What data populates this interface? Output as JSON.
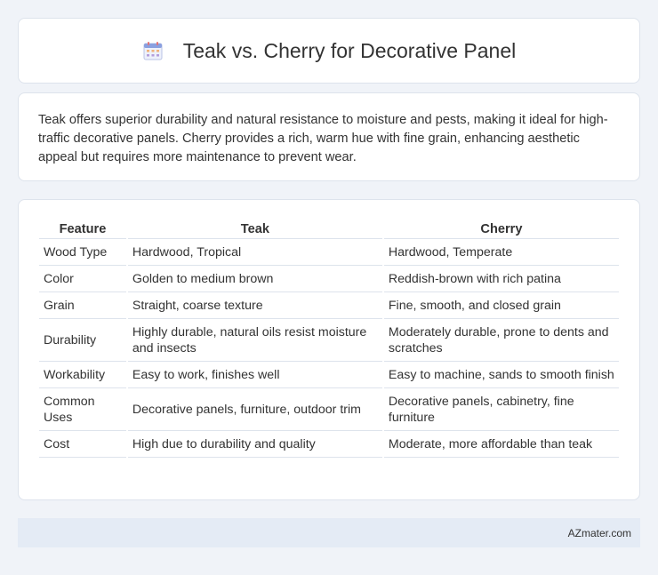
{
  "header": {
    "title": "Teak vs. Cherry for Decorative Panel",
    "icon": "calendar-icon"
  },
  "intro": {
    "text": "Teak offers superior durability and natural resistance to moisture and pests, making it ideal for high-traffic decorative panels. Cherry provides a rich, warm hue with fine grain, enhancing aesthetic appeal but requires more maintenance to prevent wear."
  },
  "table": {
    "headers": [
      "Feature",
      "Teak",
      "Cherry"
    ],
    "rows": [
      [
        "Wood Type",
        "Hardwood, Tropical",
        "Hardwood, Temperate"
      ],
      [
        "Color",
        "Golden to medium brown",
        "Reddish-brown with rich patina"
      ],
      [
        "Grain",
        "Straight, coarse texture",
        "Fine, smooth, and closed grain"
      ],
      [
        "Durability",
        "Highly durable, natural oils resist moisture and insects",
        "Moderately durable, prone to dents and scratches"
      ],
      [
        "Workability",
        "Easy to work, finishes well",
        "Easy to machine, sands to smooth finish"
      ],
      [
        "Common Uses",
        "Decorative panels, furniture, outdoor trim",
        "Decorative panels, cabinetry, fine furniture"
      ],
      [
        "Cost",
        "High due to durability and quality",
        "Moderate, more affordable than teak"
      ]
    ]
  },
  "footer": {
    "brand": "AZmater.com"
  }
}
